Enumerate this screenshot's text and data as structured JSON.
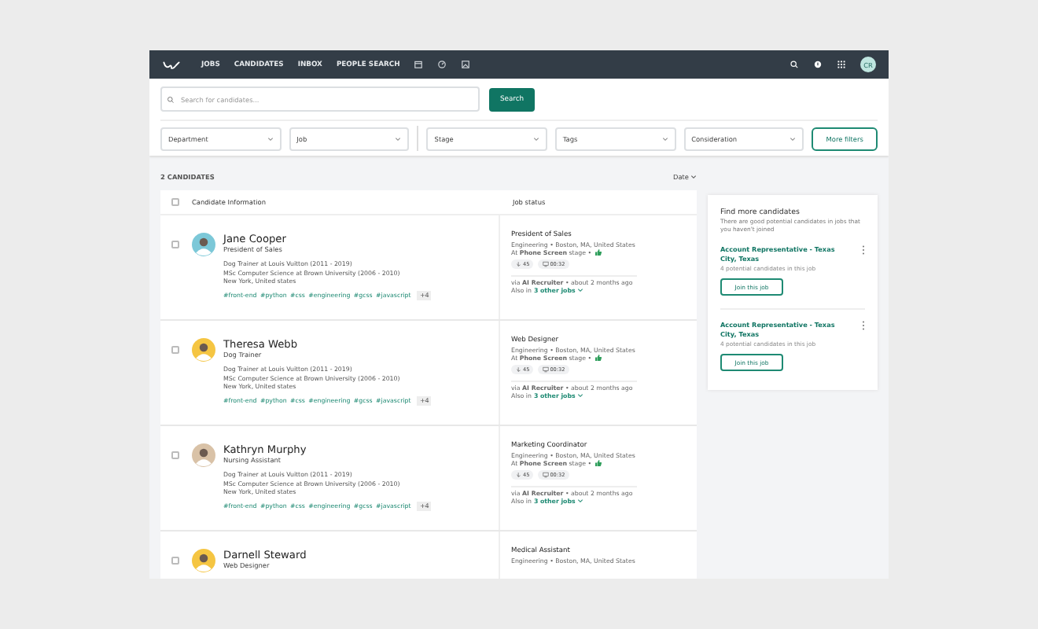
{
  "nav": {
    "links": [
      "JOBS",
      "CANDIDATES",
      "INBOX",
      "PEOPLE SEARCH"
    ],
    "avatar": "CR"
  },
  "search": {
    "placeholder": "Search for candidates...",
    "button": "Search"
  },
  "filters": [
    "Department",
    "Job",
    "Stage",
    "Tags",
    "Consideration"
  ],
  "more_filters": "More filters",
  "count": "2 CANDIDATES",
  "sort": "Date",
  "table": {
    "select_all_checked": false,
    "columns": [
      "Candidate Information",
      "Job status"
    ],
    "rows": [
      {
        "checked": false,
        "name": "Jane Cooper",
        "title": "President of Sales",
        "color": "#7cc8d8",
        "details": [
          "Dog Trainer at Louis Vuitton (2011 - 2019)",
          "MSc Computer Science at Brown University (2006 - 2010)",
          "New York, United states"
        ],
        "tags": [
          "#front-end",
          "#python",
          "#css",
          "#engineering",
          "#gcss",
          "#javascript"
        ],
        "more": "+4",
        "job": "President of Sales",
        "job_meta": "Engineering • Boston, MA, United States",
        "stage": "At **Phone Screen** stage •",
        "counts": [
          "45",
          "00:32"
        ],
        "via": "via **AI Recruiter** • about 2 months ago",
        "also_prefix": "Also in",
        "also_link": "3 other jobs"
      },
      {
        "checked": false,
        "name": "Theresa Webb",
        "title": "Dog Trainer",
        "color": "#f5c542",
        "details": [
          "Dog Trainer at Louis Vuitton (2011 - 2019)",
          "MSc Computer Science at Brown University (2006 - 2010)",
          "New York, United states"
        ],
        "tags": [
          "#front-end",
          "#python",
          "#css",
          "#engineering",
          "#gcss",
          "#javascript"
        ],
        "more": "+4",
        "job": "Web Designer",
        "job_meta": "Engineering • Boston, MA, United States",
        "stage": "At **Phone Screen** stage •",
        "counts": [
          "45",
          "00:32"
        ],
        "via": "via **AI Recruiter** • about 2 months ago",
        "also_prefix": "Also in",
        "also_link": "3 other jobs"
      },
      {
        "checked": false,
        "name": "Kathryn Murphy",
        "title": "Nursing Assistant",
        "color": "#d9c2a7",
        "details": [
          "Dog Trainer at Louis Vuitton (2011 - 2019)",
          "MSc Computer Science at Brown University (2006 - 2010)",
          "New York, United states"
        ],
        "tags": [
          "#front-end",
          "#python",
          "#css",
          "#engineering",
          "#gcss",
          "#javascript"
        ],
        "more": "+4",
        "job": "Marketing Coordinator",
        "job_meta": "Engineering • Boston, MA, United States",
        "stage": "At **Phone Screen** stage •",
        "counts": [
          "45",
          "00:32"
        ],
        "via": "via **AI Recruiter** • about 2 months ago",
        "also_prefix": "Also in",
        "also_link": "3 other jobs"
      },
      {
        "checked": false,
        "name": "Darnell Steward",
        "title": "Web Designer",
        "color": "#f5c542",
        "job": "Medical Assistant",
        "job_meta": "Engineering • Boston, MA, United States"
      }
    ]
  },
  "panel": {
    "title": "Find more candidates",
    "text": "There are good potential candidates in jobs that you haven't joined",
    "jobs": [
      {
        "title": "Account Representative - Texas City, Texas",
        "sub": "4 potential candidates in this job",
        "button": "Join this job"
      },
      {
        "title": "Account Representative - Texas City, Texas",
        "sub": "4 potential candidates in this job",
        "button": "Join this job"
      }
    ]
  }
}
